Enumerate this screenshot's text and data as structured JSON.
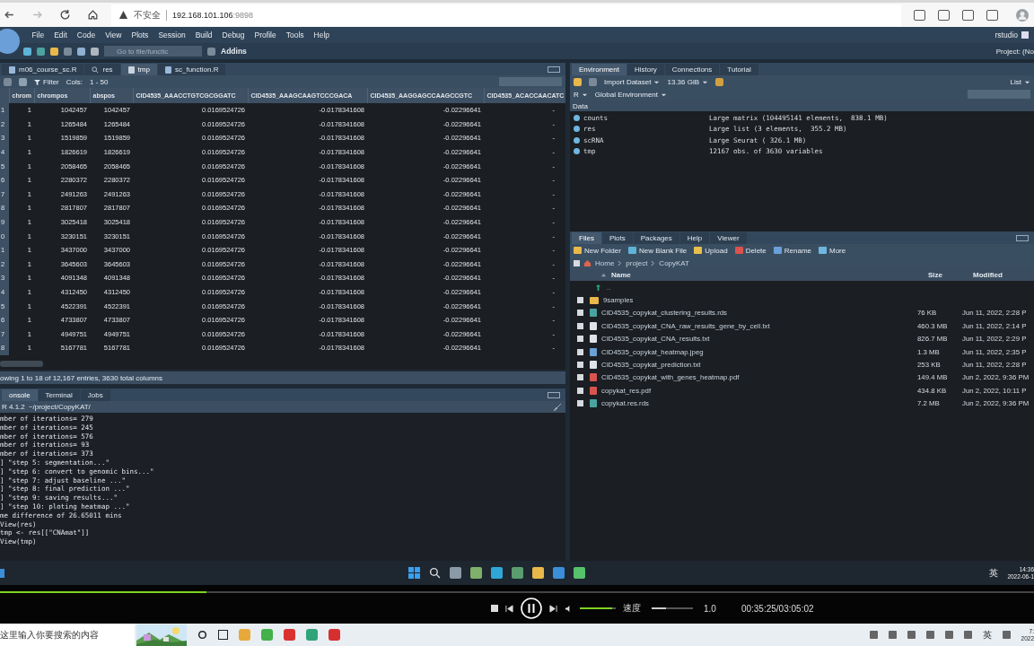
{
  "browser": {
    "insecure_label": "不安全",
    "url_host": "192.168.101.106",
    "url_port": ":9898"
  },
  "rstudio": {
    "menu": [
      "File",
      "Edit",
      "Code",
      "View",
      "Plots",
      "Session",
      "Build",
      "Debug",
      "Profile",
      "Tools",
      "Help"
    ],
    "user": "rstudio",
    "goto_placeholder": "Go to file/functic",
    "addins": "Addins",
    "project": "Project: (No"
  },
  "source_pane": {
    "tabs": [
      {
        "label": "m06_course_sc.R",
        "kind": "script",
        "selected": false
      },
      {
        "label": "res",
        "kind": "viewer",
        "selected": false
      },
      {
        "label": "tmp",
        "kind": "data",
        "selected": true
      },
      {
        "label": "sc_function.R",
        "kind": "script",
        "selected": false
      }
    ],
    "filter": "Filter",
    "cols_label": "Cols:",
    "cols_range": "1 - 50",
    "table": {
      "columns": [
        "",
        "chrom",
        "chrompos",
        "abspos",
        "CID4535_AAACCTGTCGCGGATC",
        "CID4535_AAAGCAAGTCCCGACA",
        "CID4535_AAGGAGCCAAGCCGTC",
        "CID4535_ACACCAACATC"
      ],
      "rows": [
        [
          "1",
          "1",
          "1042457",
          "1042457",
          "0.0169524726",
          "-0.0178341608",
          "-0.02296641",
          "-"
        ],
        [
          "2",
          "1",
          "1265484",
          "1265484",
          "0.0169524726",
          "-0.0178341608",
          "-0.02296641",
          "-"
        ],
        [
          "3",
          "1",
          "1519859",
          "1519859",
          "0.0169524726",
          "-0.0178341608",
          "-0.02296641",
          "-"
        ],
        [
          "4",
          "1",
          "1826619",
          "1826619",
          "0.0169524726",
          "-0.0178341608",
          "-0.02296641",
          "-"
        ],
        [
          "5",
          "1",
          "2058465",
          "2058465",
          "0.0169524726",
          "-0.0178341608",
          "-0.02296641",
          "-"
        ],
        [
          "6",
          "1",
          "2280372",
          "2280372",
          "0.0169524726",
          "-0.0178341608",
          "-0.02296641",
          "-"
        ],
        [
          "7",
          "1",
          "2491263",
          "2491263",
          "0.0169524726",
          "-0.0178341608",
          "-0.02296641",
          "-"
        ],
        [
          "8",
          "1",
          "2817807",
          "2817807",
          "0.0169524726",
          "-0.0178341608",
          "-0.02296641",
          "-"
        ],
        [
          "9",
          "1",
          "3025418",
          "3025418",
          "0.0169524726",
          "-0.0178341608",
          "-0.02296641",
          "-"
        ],
        [
          "0",
          "1",
          "3230151",
          "3230151",
          "0.0169524726",
          "-0.0178341608",
          "-0.02296641",
          "-"
        ],
        [
          "1",
          "1",
          "3437000",
          "3437000",
          "0.0169524726",
          "-0.0178341608",
          "-0.02296641",
          "-"
        ],
        [
          "2",
          "1",
          "3645603",
          "3645603",
          "0.0169524726",
          "-0.0178341608",
          "-0.02296641",
          "-"
        ],
        [
          "3",
          "1",
          "4091348",
          "4091348",
          "0.0169524726",
          "-0.0178341608",
          "-0.02296641",
          "-"
        ],
        [
          "4",
          "1",
          "4312450",
          "4312450",
          "0.0169524726",
          "-0.0178341608",
          "-0.02296641",
          "-"
        ],
        [
          "5",
          "1",
          "4522391",
          "4522391",
          "0.0169524726",
          "-0.0178341608",
          "-0.02296641",
          "-"
        ],
        [
          "6",
          "1",
          "4733807",
          "4733807",
          "0.0169524726",
          "-0.0178341608",
          "-0.02296641",
          "-"
        ],
        [
          "7",
          "1",
          "4949751",
          "4949751",
          "0.0169524726",
          "-0.0178341608",
          "-0.02296641",
          "-"
        ],
        [
          "8",
          "1",
          "5167781",
          "5167781",
          "0.0169524726",
          "-0.0178341608",
          "-0.02296641",
          "-"
        ]
      ]
    },
    "status": "owing 1 to 18 of 12,167 entries, 3630 total columns"
  },
  "console_pane": {
    "tabs": [
      {
        "label": "onsole",
        "selected": true
      },
      {
        "label": "Terminal",
        "selected": false
      },
      {
        "label": "Jobs",
        "selected": false
      }
    ],
    "version": "R 4.1.2",
    "path": "~/project/CopyKAT/",
    "lines": [
      "mber of iterations= 279",
      "mber of iterations= 245",
      "mber of iterations= 576",
      "mber of iterations= 93",
      "mber of iterations= 373",
      "] \"step 5: segmentation...\"",
      "] \"step 6: convert to genomic bins...\"",
      "] \"step 7: adjust baseline ...\"",
      "] \"step 8: final prediction ...\"",
      "] \"step 9: saving results...\"",
      "] \"step 10: ploting heatmap ...\"",
      "me difference of 26.65011 mins",
      "View(res)",
      "tmp <- res[[\"CNAmat\"]]",
      "View(tmp)"
    ]
  },
  "environment_pane": {
    "tabs": [
      {
        "label": "Environment",
        "selected": true
      },
      {
        "label": "History",
        "selected": false
      },
      {
        "label": "Connections",
        "selected": false
      },
      {
        "label": "Tutorial",
        "selected": false
      }
    ],
    "import": "Import Dataset",
    "memory": "13.36 GiB",
    "view": "List",
    "language": "R",
    "scope": "Global Environment",
    "section": "Data",
    "items": [
      {
        "name": "counts",
        "value": "Large matrix (104495141 elements,  838.1 MB)"
      },
      {
        "name": "res",
        "value": "Large list (3 elements,  355.2 MB)"
      },
      {
        "name": "scRNA",
        "value": "Large Seurat ( 326.1 MB)"
      },
      {
        "name": "tmp",
        "value": "12167 obs. of 3630 variables"
      }
    ]
  },
  "files_pane": {
    "tabs": [
      {
        "label": "Files",
        "selected": true
      },
      {
        "label": "Plots",
        "selected": false
      },
      {
        "label": "Packages",
        "selected": false
      },
      {
        "label": "Help",
        "selected": false
      },
      {
        "label": "Viewer",
        "selected": false
      }
    ],
    "actions": [
      {
        "label": "New Folder",
        "kind": "folder"
      },
      {
        "label": "New Blank File",
        "kind": "file"
      },
      {
        "label": "Upload",
        "kind": "upload"
      },
      {
        "label": "Delete",
        "kind": "delete"
      },
      {
        "label": "Rename",
        "kind": "rename"
      },
      {
        "label": "More",
        "kind": "more"
      }
    ],
    "select_all_checked": false,
    "breadcrumb": [
      "Home",
      "project",
      "CopyKAT"
    ],
    "columns": [
      "Name",
      "Size",
      "Modified"
    ],
    "parent": "..",
    "files": [
      {
        "name": "9samples",
        "kind": "folder",
        "checked": false
      },
      {
        "name": "CID4535_copykat_clustering_results.rds",
        "kind": "rds",
        "size": "76 KB",
        "modified": "Jun 11, 2022, 2:28 P",
        "checked": false
      },
      {
        "name": "CID4535_copykat_CNA_raw_results_gene_by_cell.txt",
        "kind": "txt",
        "size": "460.3 MB",
        "modified": "Jun 11, 2022, 2:14 P",
        "checked": false
      },
      {
        "name": "CID4535_copykat_CNA_results.txt",
        "kind": "txt",
        "size": "826.7 MB",
        "modified": "Jun 11, 2022, 2:29 P",
        "checked": false
      },
      {
        "name": "CID4535_copykat_heatmap.jpeg",
        "size": "1.3 MB",
        "modified": "Jun 11, 2022, 2:35 P",
        "checked": false
      },
      {
        "name": "CID4535_copykat_prediction.txt",
        "kind": "txt",
        "size": "253 KB",
        "modified": "Jun 11, 2022, 2:28 P",
        "checked": false
      },
      {
        "name": "CID4535_copykat_with_genes_heatmap.pdf",
        "kind": "pdf",
        "size": "149.4 MB",
        "modified": "Jun 2, 2022, 9:36 PM",
        "checked": false
      },
      {
        "name": "copykat_res.pdf",
        "kind": "pdf",
        "size": "434.8 KB",
        "modified": "Jun 2, 2022, 10:11 P",
        "checked": false
      },
      {
        "name": "copykat.res.rds",
        "kind": "rds",
        "size": "7.2 MB",
        "modified": "Jun 2, 2022, 9:36 PM",
        "checked": false
      }
    ]
  },
  "recorded_taskbar": {
    "ime": "英",
    "time": "14:36",
    "date": "2022-06-1"
  },
  "player": {
    "progress": {
      "level": 0.2
    },
    "volume": {
      "level": 0.9
    },
    "speed_label": "速度",
    "speed": {
      "level": 0.35
    },
    "speed_value": "1.0",
    "time": "00:35:25/03:05:02",
    "playing": true
  },
  "host_taskbar": {
    "search_placeholder": "这里输入你要搜索的内容",
    "ime": "英",
    "time": "7:",
    "date": "2022"
  }
}
